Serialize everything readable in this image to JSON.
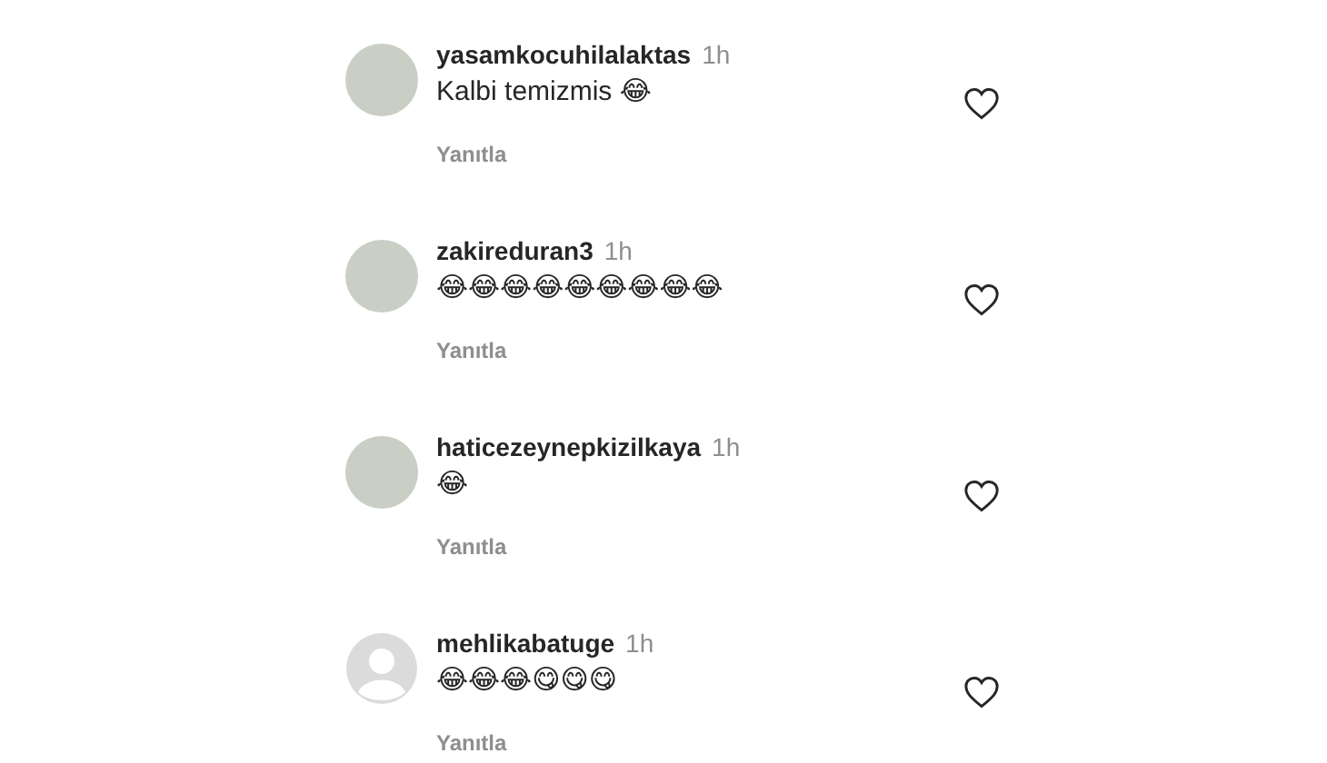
{
  "comments": [
    {
      "username": "yasamkocuhilalaktas",
      "time": "1h",
      "text": "Kalbi temizmis 😂",
      "avatar": {
        "kind": "photo"
      },
      "reply": "Yanıtla"
    },
    {
      "username": "zakireduran3",
      "time": "1h",
      "text": "😂😂😂😂😂😂😂😂😂",
      "avatar": {
        "kind": "photo"
      },
      "reply": "Yanıtla"
    },
    {
      "username": "haticezeynepkizilkaya",
      "time": "1h",
      "text": "😂",
      "avatar": {
        "kind": "photo"
      },
      "reply": "Yanıtla"
    },
    {
      "username": "mehlikabatuge",
      "time": "1h",
      "text": "😂😂😂😋😋😋",
      "avatar": {
        "kind": "default"
      },
      "reply": "Yanıtla"
    }
  ]
}
